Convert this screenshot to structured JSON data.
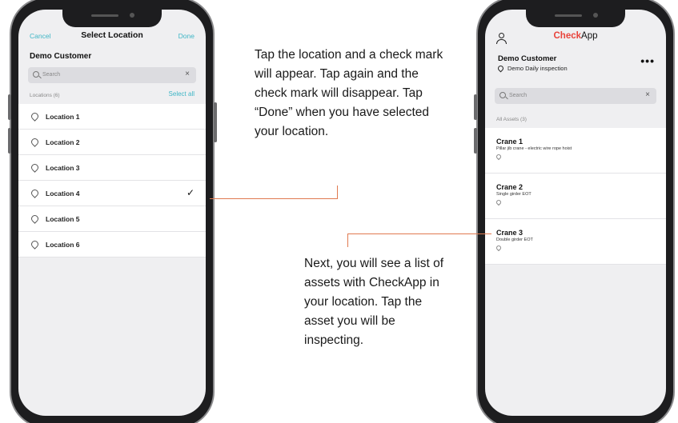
{
  "left_phone": {
    "header": {
      "cancel": "Cancel",
      "title": "Select Location",
      "done": "Done"
    },
    "customer": "Demo Customer",
    "search_placeholder": "Search",
    "clear_icon": "×",
    "locations_count": "Locations (6)",
    "select_all": "Select all",
    "locations": [
      {
        "label": "Location 1",
        "checked": false
      },
      {
        "label": "Location 2",
        "checked": false
      },
      {
        "label": "Location 3",
        "checked": false
      },
      {
        "label": "Location 4",
        "checked": true
      },
      {
        "label": "Location 5",
        "checked": false
      },
      {
        "label": "Location 6",
        "checked": false
      }
    ],
    "check_glyph": "✓"
  },
  "right_phone": {
    "logo": {
      "bold_part": "Check",
      "regular_part": "App"
    },
    "customer": "Demo Customer",
    "inspection": "Demo Daily inspection",
    "more_glyph": "•••",
    "search_placeholder": "Search",
    "clear_icon": "×",
    "assets_count": "All Assets (3)",
    "assets": [
      {
        "name": "Crane 1",
        "description": "Pillar jib crane - electric wire rope hoist"
      },
      {
        "name": "Crane 2",
        "description": "Single girder EOT"
      },
      {
        "name": "Crane 3",
        "description": "Double girder EOT"
      }
    ]
  },
  "callouts": {
    "first": "Tap the location and a check mark will appear. Tap again and the check mark will disappear. Tap “Done” when you have selected your location.",
    "second": "Next, you will see a list of assets with CheckApp in your location. Tap the asset you will be inspecting."
  },
  "colors": {
    "accent": "#3fb6c6",
    "brand_red": "#e8433b",
    "callout_line": "#e07a50"
  }
}
